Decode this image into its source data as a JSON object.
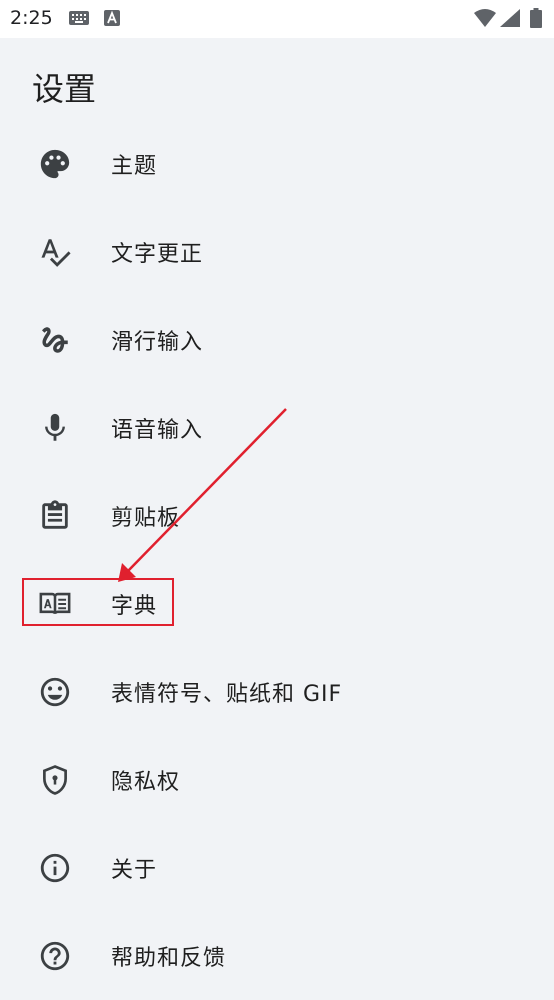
{
  "status_bar": {
    "time": "2:25",
    "icons": [
      "keyboard-icon",
      "a-badge-icon",
      "wifi-icon",
      "signal-icon",
      "battery-icon"
    ]
  },
  "page": {
    "title": "设置"
  },
  "menu": {
    "items": [
      {
        "label": "主题",
        "icon": "palette-icon"
      },
      {
        "label": "文字更正",
        "icon": "spellcheck-icon"
      },
      {
        "label": "滑行输入",
        "icon": "gesture-icon"
      },
      {
        "label": "语音输入",
        "icon": "mic-icon"
      },
      {
        "label": "剪贴板",
        "icon": "clipboard-icon"
      },
      {
        "label": "字典",
        "icon": "dictionary-icon"
      },
      {
        "label": "表情符号、贴纸和 GIF",
        "icon": "emoji-icon"
      },
      {
        "label": "隐私权",
        "icon": "privacy-shield-icon"
      },
      {
        "label": "关于",
        "icon": "info-icon"
      },
      {
        "label": "帮助和反馈",
        "icon": "help-icon"
      }
    ]
  },
  "annotation": {
    "highlighted_item": "字典",
    "color": "#e0202e"
  },
  "colors": {
    "background": "#f1f3f6",
    "text": "#1f1f1f",
    "icon": "#3c4043"
  }
}
